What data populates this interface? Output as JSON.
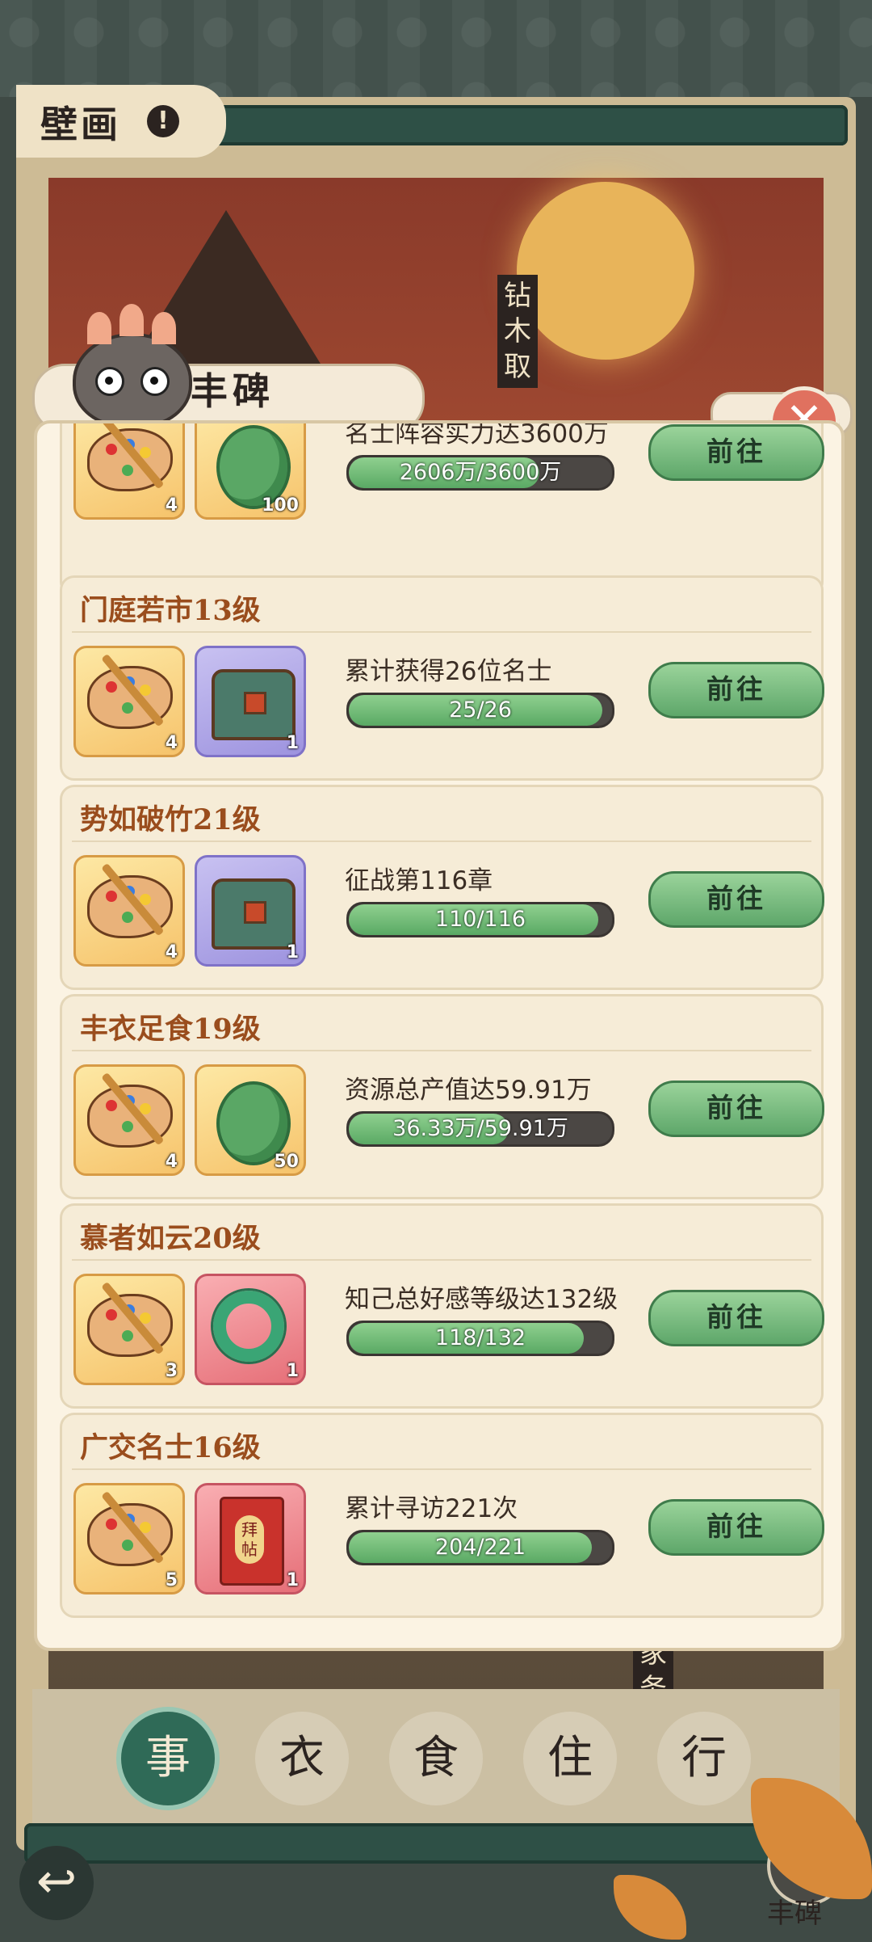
{
  "header": {
    "title": "壁画",
    "help_icon": "!"
  },
  "mural": {
    "vertical_text_top": "钻木取",
    "vertical_text_bottom": "家务"
  },
  "dialog": {
    "title": "丰碑",
    "close_icon": "✕",
    "cards": [
      {
        "name": "",
        "rewards": [
          {
            "icon": "palette-icon",
            "qty": "4",
            "frame": "gold"
          },
          {
            "icon": "jade-icon",
            "qty": "100",
            "frame": "gold"
          }
        ],
        "task": "名士阵容实力达3600万",
        "progress_text": "2606万/3600万",
        "progress": 0.724,
        "button": "前往"
      },
      {
        "name": "门庭若市13级",
        "rewards": [
          {
            "icon": "palette-icon",
            "qty": "4",
            "frame": "gold"
          },
          {
            "icon": "chest-icon",
            "qty": "1",
            "frame": "purple"
          }
        ],
        "task": "累计获得26位名士",
        "progress_text": "25/26",
        "progress": 0.962,
        "button": "前往"
      },
      {
        "name": "势如破竹21级",
        "rewards": [
          {
            "icon": "palette-icon",
            "qty": "4",
            "frame": "gold"
          },
          {
            "icon": "chest-icon",
            "qty": "1",
            "frame": "purple"
          }
        ],
        "task": "征战第116章",
        "progress_text": "110/116",
        "progress": 0.948,
        "button": "前往"
      },
      {
        "name": "丰衣足食19级",
        "rewards": [
          {
            "icon": "palette-icon",
            "qty": "4",
            "frame": "gold"
          },
          {
            "icon": "jade-icon",
            "qty": "50",
            "frame": "gold"
          }
        ],
        "task": "资源总产值达59.91万",
        "progress_text": "36.33万/59.91万",
        "progress": 0.606,
        "button": "前往"
      },
      {
        "name": "慕者如云20级",
        "rewards": [
          {
            "icon": "palette-icon",
            "qty": "3",
            "frame": "gold"
          },
          {
            "icon": "jade-ring-icon",
            "qty": "1",
            "frame": "red"
          }
        ],
        "task": "知己总好感等级达132级",
        "progress_text": "118/132",
        "progress": 0.894,
        "button": "前往"
      },
      {
        "name": "广交名士16级",
        "rewards": [
          {
            "icon": "palette-icon",
            "qty": "5",
            "frame": "gold"
          },
          {
            "icon": "invitation-icon",
            "qty": "1",
            "frame": "red"
          }
        ],
        "task": "累计寻访221次",
        "progress_text": "204/221",
        "progress": 0.923,
        "button": "前往"
      }
    ]
  },
  "tabs": [
    {
      "label": "事",
      "active": true
    },
    {
      "label": "衣",
      "active": false
    },
    {
      "label": "食",
      "active": false
    },
    {
      "label": "住",
      "active": false
    },
    {
      "label": "行",
      "active": false
    }
  ],
  "footer": {
    "back_icon": "↩",
    "stele_label": "丰碑"
  },
  "colors": {
    "accent_green": "#5ea76a",
    "card_title": "#9a4d1d",
    "panel_bg": "#fbf3e3"
  }
}
